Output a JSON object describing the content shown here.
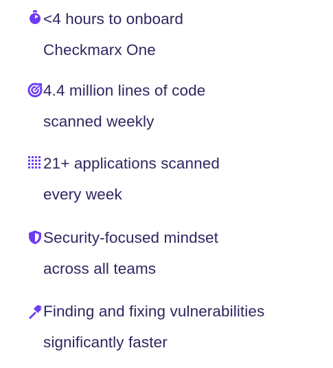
{
  "accent_color": "#6d3cf5",
  "text_color": "#2e2660",
  "stats": [
    {
      "icon": "stopwatch-icon",
      "line1": "<4 hours to onboard",
      "line2": "Checkmarx One"
    },
    {
      "icon": "target-icon",
      "line1": "4.4 million lines of code",
      "line2": "scanned weekly"
    },
    {
      "icon": "grid-dots-icon",
      "line1": "21+ applications scanned",
      "line2": "every week"
    },
    {
      "icon": "shield-icon",
      "line1": "Security-focused mindset",
      "line2": "across all teams"
    },
    {
      "icon": "hammer-icon",
      "line1": "Finding and fixing vulnerabilities",
      "line2": "significantly faster"
    }
  ]
}
